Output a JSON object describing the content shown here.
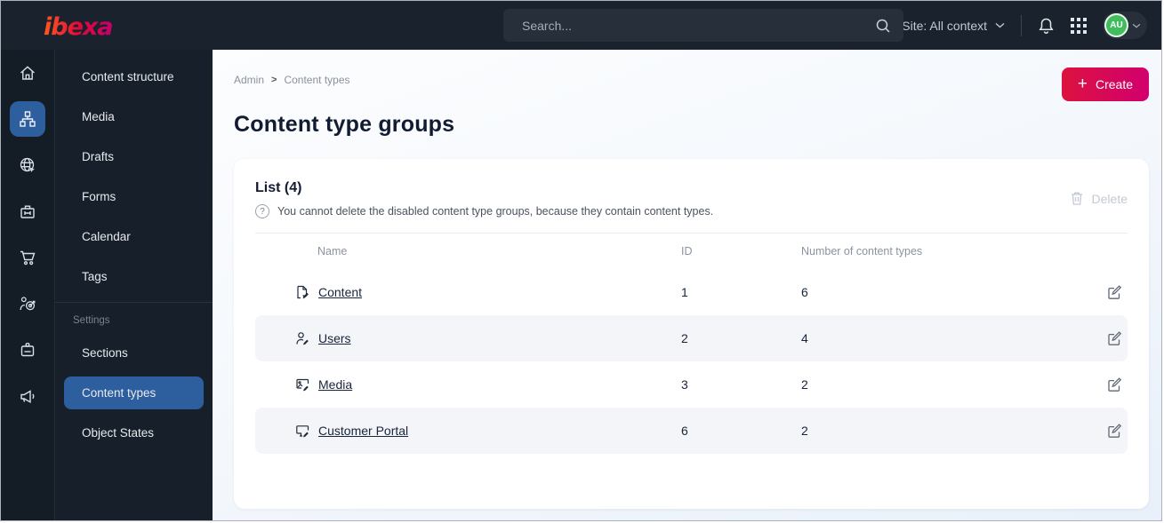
{
  "colors": {
    "topbar_bg": "#1a222d",
    "rail_bg": "#141c26",
    "menu_bg": "#161f2a",
    "active_blue": "#2d5f9e",
    "brand_red": "#dc1240",
    "brand_pink": "#d1006e",
    "avatar_green": "#41bd5d",
    "disabled_gray": "#c3c9d3"
  },
  "topbar": {
    "logo": "ibexa",
    "search_placeholder": "Search...",
    "site_context": "Site: All context",
    "avatar_initials": "AU"
  },
  "sidebar": {
    "rail_icons": [
      "home",
      "sitemap",
      "globe-cursor",
      "package",
      "cart",
      "target-user",
      "id-badge",
      "megaphone"
    ],
    "active_rail_icon": "sitemap",
    "menu_items": [
      "Content structure",
      "Media",
      "Drafts",
      "Forms",
      "Calendar",
      "Tags"
    ],
    "settings": {
      "label": "Settings",
      "items": [
        "Sections",
        "Content types",
        "Object States"
      ],
      "active_item": "Content types"
    }
  },
  "breadcrumb": {
    "items": [
      "Admin",
      "Content types"
    ],
    "separator": ">"
  },
  "page": {
    "title": "Content type groups"
  },
  "actions": {
    "create_label": "Create",
    "create_plus": "+",
    "delete_label": "Delete"
  },
  "list": {
    "title": "List (4)",
    "help_text": "You cannot delete the disabled content type groups, because they contain content types.",
    "columns": {
      "name": "Name",
      "id": "ID",
      "count": "Number of content types"
    },
    "rows": [
      {
        "name": "Content",
        "id": "1",
        "count": "6",
        "icon": "file-edit-icon"
      },
      {
        "name": "Users",
        "id": "2",
        "count": "4",
        "icon": "user-edit-icon"
      },
      {
        "name": "Media",
        "id": "3",
        "count": "2",
        "icon": "image-edit-icon"
      },
      {
        "name": "Customer Portal",
        "id": "6",
        "count": "2",
        "icon": "monitor-edit-icon"
      }
    ]
  }
}
